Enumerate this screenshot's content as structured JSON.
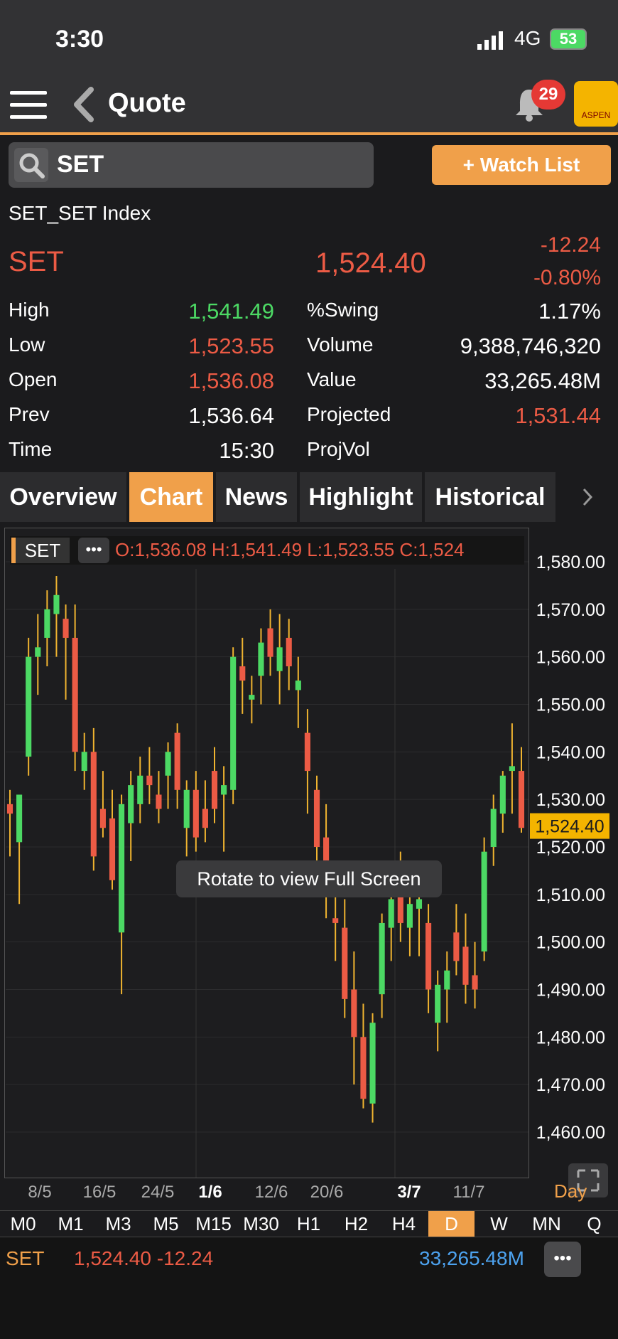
{
  "status": {
    "time": "3:30",
    "network": "4G",
    "battery": "53"
  },
  "nav": {
    "title": "Quote",
    "badge": "29",
    "logo": "ASPEN"
  },
  "search": {
    "value": "SET"
  },
  "watchlist_label": "+ Watch List",
  "quote": {
    "fullname": "SET_SET Index",
    "symbol": "SET",
    "last": "1,524.40",
    "change": "-12.24",
    "change_pct": "-0.80%",
    "stats_left": [
      {
        "label": "High",
        "value": "1,541.49",
        "color": "#4cd964"
      },
      {
        "label": "Low",
        "value": "1,523.55",
        "color": "#ec5b45"
      },
      {
        "label": "Open",
        "value": "1,536.08",
        "color": "#ec5b45"
      },
      {
        "label": "Prev",
        "value": "1,536.64",
        "color": "#ffffff"
      },
      {
        "label": "Time",
        "value": "15:30",
        "color": "#ffffff"
      }
    ],
    "stats_right": [
      {
        "label": "%Swing",
        "value": "1.17%",
        "color": "#ffffff"
      },
      {
        "label": "Volume",
        "value": "9,388,746,320",
        "color": "#ffffff"
      },
      {
        "label": "Value",
        "value": "33,265.48M",
        "color": "#ffffff"
      },
      {
        "label": "Projected",
        "value": "1,531.44",
        "color": "#ec5b45"
      },
      {
        "label": "ProjVol",
        "value": "",
        "color": "#ffffff"
      }
    ]
  },
  "tabs": [
    "Overview",
    "Chart",
    "News",
    "Highlight",
    "Historical"
  ],
  "active_tab": "Chart",
  "chart": {
    "symbol": "SET",
    "ohlc": "O:1,536.08  H:1,541.49  L:1,523.55  C:1,524",
    "rotate_hint": "Rotate to view Full Screen",
    "period_label": "Day",
    "price_tag": "1,524.40"
  },
  "chart_data": {
    "type": "candlestick",
    "ylim": [
      1455,
      1585
    ],
    "y_ticks": [
      "1,580.00",
      "1,570.00",
      "1,560.00",
      "1,550.00",
      "1,540.00",
      "1,530.00",
      "1,520.00",
      "1,510.00",
      "1,500.00",
      "1,490.00",
      "1,480.00",
      "1,470.00",
      "1,460.00"
    ],
    "x_ticks": [
      "8/5",
      "16/5",
      "24/5",
      "1/6",
      "12/6",
      "20/6",
      "3/7",
      "11/7"
    ],
    "candles": [
      {
        "o": 1529,
        "h": 1532,
        "l": 1518,
        "c": 1527
      },
      {
        "o": 1521,
        "h": 1531,
        "l": 1508,
        "c": 1531
      },
      {
        "o": 1539,
        "h": 1564,
        "l": 1535,
        "c": 1560
      },
      {
        "o": 1560,
        "h": 1569,
        "l": 1552,
        "c": 1562
      },
      {
        "o": 1564,
        "h": 1574,
        "l": 1558,
        "c": 1570
      },
      {
        "o": 1569,
        "h": 1577,
        "l": 1560,
        "c": 1573
      },
      {
        "o": 1568,
        "h": 1571,
        "l": 1551,
        "c": 1564
      },
      {
        "o": 1564,
        "h": 1571,
        "l": 1536,
        "c": 1540
      },
      {
        "o": 1536,
        "h": 1544,
        "l": 1532,
        "c": 1540
      },
      {
        "o": 1540,
        "h": 1545,
        "l": 1515,
        "c": 1518
      },
      {
        "o": 1528,
        "h": 1536,
        "l": 1522,
        "c": 1524
      },
      {
        "o": 1526,
        "h": 1532,
        "l": 1511,
        "c": 1513
      },
      {
        "o": 1502,
        "h": 1531,
        "l": 1489,
        "c": 1529
      },
      {
        "o": 1525,
        "h": 1536,
        "l": 1517,
        "c": 1533
      },
      {
        "o": 1529,
        "h": 1539,
        "l": 1525,
        "c": 1535
      },
      {
        "o": 1535,
        "h": 1541,
        "l": 1529,
        "c": 1533
      },
      {
        "o": 1531,
        "h": 1536,
        "l": 1525,
        "c": 1528
      },
      {
        "o": 1535,
        "h": 1542,
        "l": 1528,
        "c": 1540
      },
      {
        "o": 1544,
        "h": 1546,
        "l": 1528,
        "c": 1532
      },
      {
        "o": 1524,
        "h": 1534,
        "l": 1518,
        "c": 1532
      },
      {
        "o": 1532,
        "h": 1536,
        "l": 1519,
        "c": 1522
      },
      {
        "o": 1528,
        "h": 1534,
        "l": 1521,
        "c": 1524
      },
      {
        "o": 1536,
        "h": 1541,
        "l": 1525,
        "c": 1528
      },
      {
        "o": 1531,
        "h": 1537,
        "l": 1519,
        "c": 1533
      },
      {
        "o": 1532,
        "h": 1562,
        "l": 1529,
        "c": 1560
      },
      {
        "o": 1558,
        "h": 1564,
        "l": 1548,
        "c": 1555
      },
      {
        "o": 1551,
        "h": 1556,
        "l": 1546,
        "c": 1552
      },
      {
        "o": 1556,
        "h": 1566,
        "l": 1550,
        "c": 1563
      },
      {
        "o": 1566,
        "h": 1570,
        "l": 1556,
        "c": 1560
      },
      {
        "o": 1557,
        "h": 1569,
        "l": 1550,
        "c": 1562
      },
      {
        "o": 1564,
        "h": 1568,
        "l": 1553,
        "c": 1558
      },
      {
        "o": 1553,
        "h": 1560,
        "l": 1545,
        "c": 1555
      },
      {
        "o": 1544,
        "h": 1549,
        "l": 1527,
        "c": 1536
      },
      {
        "o": 1532,
        "h": 1535,
        "l": 1516,
        "c": 1520
      },
      {
        "o": 1522,
        "h": 1529,
        "l": 1505,
        "c": 1512
      },
      {
        "o": 1505,
        "h": 1510,
        "l": 1496,
        "c": 1504
      },
      {
        "o": 1503,
        "h": 1509,
        "l": 1484,
        "c": 1488
      },
      {
        "o": 1490,
        "h": 1498,
        "l": 1470,
        "c": 1480
      },
      {
        "o": 1480,
        "h": 1487,
        "l": 1465,
        "c": 1467
      },
      {
        "o": 1466,
        "h": 1485,
        "l": 1462,
        "c": 1483
      },
      {
        "o": 1489,
        "h": 1506,
        "l": 1484,
        "c": 1504
      },
      {
        "o": 1503,
        "h": 1513,
        "l": 1496,
        "c": 1509
      },
      {
        "o": 1511,
        "h": 1519,
        "l": 1500,
        "c": 1504
      },
      {
        "o": 1503,
        "h": 1513,
        "l": 1497,
        "c": 1508
      },
      {
        "o": 1507,
        "h": 1513,
        "l": 1497,
        "c": 1509
      },
      {
        "o": 1504,
        "h": 1508,
        "l": 1485,
        "c": 1490
      },
      {
        "o": 1483,
        "h": 1494,
        "l": 1477,
        "c": 1491
      },
      {
        "o": 1490,
        "h": 1498,
        "l": 1483,
        "c": 1494
      },
      {
        "o": 1502,
        "h": 1508,
        "l": 1493,
        "c": 1496
      },
      {
        "o": 1499,
        "h": 1506,
        "l": 1487,
        "c": 1491
      },
      {
        "o": 1493,
        "h": 1500,
        "l": 1486,
        "c": 1490
      },
      {
        "o": 1498,
        "h": 1522,
        "l": 1496,
        "c": 1519
      },
      {
        "o": 1520,
        "h": 1531,
        "l": 1516,
        "c": 1528
      },
      {
        "o": 1527,
        "h": 1536,
        "l": 1523,
        "c": 1535
      },
      {
        "o": 1536,
        "h": 1546,
        "l": 1527,
        "c": 1537
      },
      {
        "o": 1536,
        "h": 1541,
        "l": 1523,
        "c": 1524
      }
    ]
  },
  "timeframes": [
    "M0",
    "M1",
    "M3",
    "M5",
    "M15",
    "M30",
    "H1",
    "H2",
    "H4",
    "D",
    "W",
    "MN",
    "Q"
  ],
  "active_timeframe": "D",
  "bottom": {
    "symbol": "SET",
    "price": "1,524.40 -12.24",
    "value": "33,265.48M"
  },
  "colors": {
    "up": "#4cd964",
    "down": "#ec5b45",
    "accent": "#f0a04a",
    "wick": "#f0b430"
  }
}
